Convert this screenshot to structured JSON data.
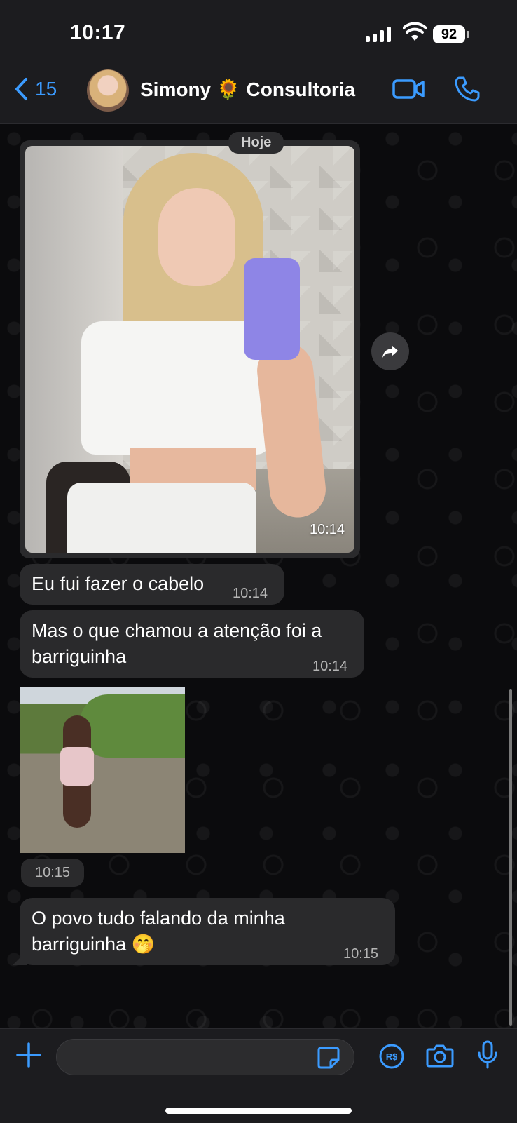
{
  "status_bar": {
    "time": "10:17",
    "battery": "92"
  },
  "header": {
    "back_count": "15",
    "contact_name": "Simony 🌻 Consultoria"
  },
  "chat": {
    "date_label": "Hoje",
    "photo_time": "10:14",
    "messages": [
      {
        "text": "Eu fui fazer o cabelo",
        "time": "10:14"
      },
      {
        "text": "Mas o que chamou a atenção foi a barriguinha",
        "time": "10:14"
      }
    ],
    "gif_time": "10:15",
    "last_message": {
      "text": "O povo tudo falando da minha barriguinha 🤭",
      "time": "10:15"
    }
  },
  "composer": {
    "placeholder": ""
  },
  "colors": {
    "accent": "#3b9bff",
    "bubble": "#2a2a2c",
    "bar": "#1c1c1f"
  }
}
